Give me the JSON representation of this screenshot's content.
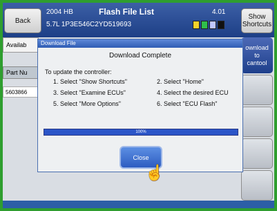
{
  "header": {
    "back_label": "Back",
    "year_model": "2004 HB",
    "title": "Flash File List",
    "version": "4.01",
    "engine_vin": "5.7L 1P3E546C2YD519693",
    "show_shortcuts_label": "Show\nShortcuts"
  },
  "tabs": {
    "available": "Availab"
  },
  "table": {
    "part_no_header": "Part Nu",
    "row_value": "5603866"
  },
  "side": {
    "download_label": "ownload\nto\ncantool"
  },
  "dialog": {
    "title": "Download File",
    "heading": "Download Complete",
    "intro": "To update the controller:",
    "steps": [
      "1. Select \"Show Shortcuts\"",
      "2. Select \"Home\"",
      "3. Select \"Examine ECUs\"",
      "4. Select the desired ECU",
      "5. Select \"More Options\"",
      "6. Select \"ECU Flash\""
    ],
    "progress_percent": 100,
    "progress_label": "100%",
    "close_label": "Close"
  }
}
